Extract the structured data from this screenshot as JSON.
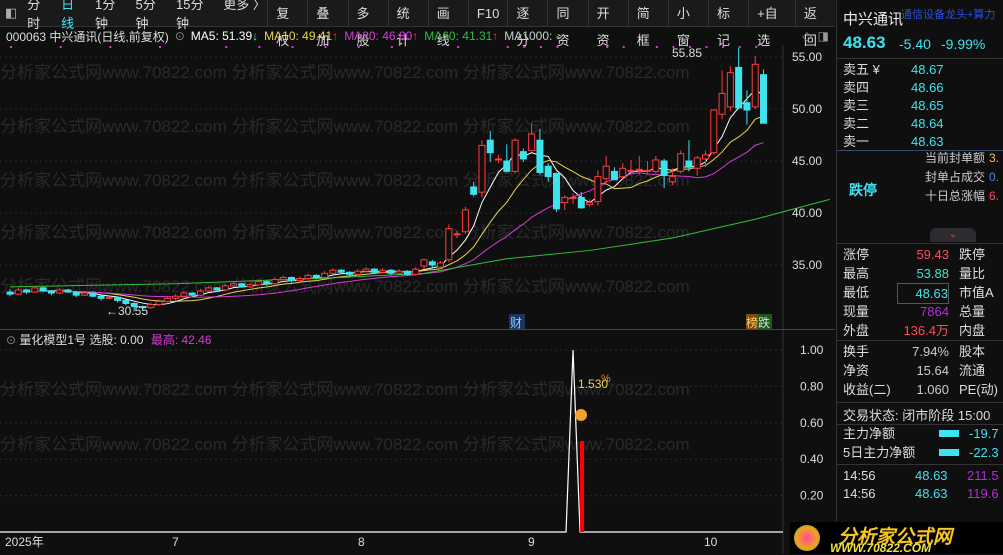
{
  "toolbar": {
    "left": [
      "分时",
      "日线",
      "1分钟",
      "5分钟",
      "15分钟",
      "更多 〉"
    ],
    "active": 1,
    "right": [
      "复权",
      "叠加",
      "多股",
      "统计",
      "画线",
      "F10",
      "逐分",
      "同资",
      "开资",
      "简框",
      "小窗",
      "标记",
      "+自选",
      "返回"
    ]
  },
  "legend": {
    "title": "000063 中兴通讯(日线,前复权)",
    "ma5": "MA5: 51.39",
    "ma5_arrow": "↓",
    "ma10": "MA10: 49.41",
    "ma10_arrow": "↑",
    "ma20": "MA20: 46.80",
    "ma20_arrow": "↑",
    "ma60": "MA60: 41.31",
    "ma60_arrow": "↑",
    "ma1000": "MA1000: -"
  },
  "colors": {
    "up": "#ff3b3b",
    "down": "#3ee3f0",
    "ma5": "#ffffff",
    "ma10": "#e8d44d",
    "ma20": "#d63ad6",
    "ma60": "#2fbf3a"
  },
  "watermark": "分析家公式网www.70822.com 分析家公式网www.70822.com 分析家公式网www.70822.com",
  "chart_data": {
    "type": "candlestick",
    "y_ticks": [
      "55.00",
      "50.00",
      "45.00",
      "40.00",
      "35.00"
    ],
    "ylim": [
      29.5,
      57.5
    ],
    "high_label": "55.85",
    "low_label": "←30.55",
    "markers": {
      "cai": "财",
      "bang": "榜",
      "die": "跌"
    },
    "ohlc": [
      [
        32.4,
        32.7,
        32.0,
        32.2
      ],
      [
        32.2,
        32.8,
        32.1,
        32.6
      ],
      [
        32.6,
        32.7,
        32.2,
        32.4
      ],
      [
        32.4,
        33.0,
        32.3,
        32.8
      ],
      [
        32.8,
        32.9,
        32.4,
        32.5
      ],
      [
        32.5,
        32.6,
        32.1,
        32.3
      ],
      [
        32.3,
        32.8,
        32.2,
        32.6
      ],
      [
        32.6,
        32.7,
        32.3,
        32.4
      ],
      [
        32.4,
        32.5,
        31.9,
        32.1
      ],
      [
        32.1,
        32.5,
        32.0,
        32.3
      ],
      [
        32.3,
        32.4,
        31.9,
        32.0
      ],
      [
        32.0,
        32.1,
        31.6,
        31.8
      ],
      [
        31.8,
        32.1,
        31.7,
        31.9
      ],
      [
        31.9,
        32.0,
        31.4,
        31.6
      ],
      [
        31.6,
        31.7,
        31.1,
        31.3
      ],
      [
        31.3,
        31.4,
        30.55,
        31.0
      ],
      [
        31.0,
        31.1,
        30.7,
        30.9
      ],
      [
        30.9,
        31.4,
        30.8,
        31.2
      ],
      [
        31.2,
        31.7,
        31.1,
        31.5
      ],
      [
        31.5,
        32.0,
        31.4,
        31.8
      ],
      [
        31.8,
        32.2,
        31.6,
        32.0
      ],
      [
        32.0,
        32.5,
        31.9,
        32.3
      ],
      [
        32.3,
        32.4,
        31.9,
        32.1
      ],
      [
        32.1,
        32.7,
        32.0,
        32.5
      ],
      [
        32.5,
        33.0,
        32.4,
        32.8
      ],
      [
        32.8,
        32.9,
        32.4,
        32.6
      ],
      [
        32.6,
        33.2,
        32.5,
        33.0
      ],
      [
        33.0,
        33.4,
        32.9,
        33.2
      ],
      [
        33.2,
        33.3,
        32.8,
        32.9
      ],
      [
        32.9,
        33.3,
        32.8,
        33.1
      ],
      [
        33.1,
        33.6,
        33.0,
        33.4
      ],
      [
        33.4,
        33.5,
        33.0,
        33.2
      ],
      [
        33.2,
        33.8,
        33.1,
        33.6
      ],
      [
        33.6,
        34.0,
        33.5,
        33.8
      ],
      [
        33.8,
        33.9,
        33.3,
        33.5
      ],
      [
        33.5,
        33.9,
        33.4,
        33.7
      ],
      [
        33.7,
        34.2,
        33.6,
        34.0
      ],
      [
        34.0,
        34.1,
        33.6,
        33.8
      ],
      [
        33.8,
        34.4,
        33.7,
        34.2
      ],
      [
        34.2,
        34.7,
        34.1,
        34.5
      ],
      [
        34.5,
        34.6,
        34.1,
        34.3
      ],
      [
        34.3,
        34.4,
        33.9,
        34.1
      ],
      [
        34.1,
        34.6,
        34.0,
        34.4
      ],
      [
        34.4,
        34.8,
        34.3,
        34.6
      ],
      [
        34.6,
        34.7,
        34.1,
        34.3
      ],
      [
        34.3,
        34.7,
        34.2,
        34.5
      ],
      [
        34.5,
        34.6,
        34.0,
        34.2
      ],
      [
        34.2,
        34.6,
        34.1,
        34.4
      ],
      [
        34.4,
        34.5,
        34.0,
        34.1
      ],
      [
        34.1,
        34.8,
        34.0,
        34.6
      ],
      [
        34.9,
        35.6,
        34.6,
        35.5
      ],
      [
        35.3,
        35.5,
        34.8,
        35.0
      ],
      [
        34.8,
        35.4,
        34.6,
        35.2
      ],
      [
        35.5,
        38.9,
        35.3,
        38.5
      ],
      [
        38.0,
        38.3,
        37.6,
        38.0
      ],
      [
        38.2,
        40.6,
        38.0,
        40.3
      ],
      [
        42.5,
        43.0,
        41.6,
        41.8
      ],
      [
        42.0,
        47.0,
        41.5,
        46.5
      ],
      [
        47.0,
        47.9,
        44.9,
        45.8
      ],
      [
        45.2,
        45.6,
        44.8,
        45.2
      ],
      [
        45.0,
        46.6,
        43.9,
        44.0
      ],
      [
        44.0,
        47.2,
        43.8,
        47.0
      ],
      [
        45.9,
        46.2,
        44.9,
        45.2
      ],
      [
        46.0,
        48.7,
        45.9,
        47.6
      ],
      [
        47.0,
        48.1,
        43.7,
        43.9
      ],
      [
        44.5,
        44.8,
        43.0,
        43.5
      ],
      [
        43.8,
        43.9,
        40.1,
        40.4
      ],
      [
        41.0,
        41.7,
        40.3,
        41.5
      ],
      [
        41.5,
        41.9,
        40.9,
        41.5
      ],
      [
        41.5,
        42.0,
        40.4,
        40.5
      ],
      [
        40.8,
        41.3,
        40.6,
        41.0
      ],
      [
        41.1,
        44.1,
        40.7,
        43.5
      ],
      [
        43.3,
        45.5,
        42.7,
        44.5
      ],
      [
        44.0,
        44.4,
        43.2,
        43.2
      ],
      [
        43.5,
        44.8,
        43.2,
        44.3
      ],
      [
        44.1,
        45.1,
        43.9,
        44.1
      ],
      [
        44.2,
        45.5,
        43.7,
        44.2
      ],
      [
        44.1,
        45.0,
        43.8,
        44.1
      ],
      [
        44.0,
        45.5,
        43.8,
        45.1
      ],
      [
        45.0,
        45.2,
        42.4,
        43.6
      ],
      [
        43.0,
        44.3,
        42.7,
        43.5
      ],
      [
        44.0,
        46.0,
        43.8,
        45.7
      ],
      [
        45.0,
        47.0,
        44.0,
        44.4
      ],
      [
        44.3,
        45.5,
        43.6,
        45.3
      ],
      [
        45.2,
        46.0,
        44.4,
        45.6
      ],
      [
        45.8,
        50.0,
        45.6,
        49.9
      ],
      [
        49.5,
        53.7,
        49.0,
        51.5
      ],
      [
        50.2,
        54.1,
        49.8,
        53.5
      ],
      [
        54.0,
        55.85,
        50.0,
        50.1
      ],
      [
        50.6,
        51.8,
        48.5,
        49.9
      ],
      [
        50.2,
        55.1,
        50.0,
        54.3
      ],
      [
        53.3,
        53.8,
        48.63,
        48.63
      ]
    ],
    "ma60": [
      [
        0,
        32.9
      ],
      [
        20,
        33.2
      ],
      [
        40,
        33.8
      ],
      [
        50,
        34.2
      ],
      [
        60,
        35.6
      ],
      [
        70,
        36.4
      ],
      [
        80,
        37.6
      ],
      [
        90,
        39.4
      ],
      [
        99,
        41.31
      ]
    ]
  },
  "indicator": {
    "title": "量化模型1号",
    "pick": "选股: 0.00",
    "high": "最高: 42.46",
    "label": "1.530",
    "pct": "%",
    "y_ticks": [
      "1.00",
      "0.80",
      "0.60",
      "0.40",
      "0.20"
    ],
    "signal_index": 68,
    "signal_value": 1.0,
    "bar_value": 0.5
  },
  "x_axis": [
    "2025年",
    "7",
    "8",
    "9",
    "10"
  ],
  "panel": {
    "name": "中兴通讯",
    "tagline": "通信设备龙头+算力",
    "price": "48.63",
    "change": "-5.40",
    "pct": "-9.99%",
    "asks": [
      {
        "l": "卖五 ¥",
        "v": "48.67"
      },
      {
        "l": "卖四",
        "v": "48.66"
      },
      {
        "l": "卖三",
        "v": "48.65"
      },
      {
        "l": "卖二",
        "v": "48.64"
      },
      {
        "l": "卖一",
        "v": "48.63"
      }
    ],
    "limit_status": "跌停",
    "seal": [
      {
        "l": "当前封单额",
        "v": "3."
      },
      {
        "l": "封单占成交",
        "v": "0."
      },
      {
        "l": "十日总涨幅",
        "v": "6."
      }
    ],
    "stats": [
      {
        "l": "涨停",
        "v": "59.43",
        "c": "#ff4a5a",
        "l2": "跌停"
      },
      {
        "l": "最高",
        "v": "53.88",
        "c": "#3ee3c8",
        "l2": "量比"
      },
      {
        "l": "最低",
        "v": "48.63",
        "c": "#3ee3f0",
        "l2": "市值A"
      },
      {
        "l": "现量",
        "v": "7864",
        "c": "#b030d0",
        "l2": "总量"
      },
      {
        "l": "外盘",
        "v": "136.4万",
        "c": "#ff4a5a",
        "l2": "内盘"
      }
    ],
    "stats2": [
      {
        "l": "换手",
        "v": "7.94%",
        "l2": "股本"
      },
      {
        "l": "净资",
        "v": "15.64",
        "l2": "流通"
      },
      {
        "l": "收益(二)",
        "v": "1.060",
        "l2": "PE(动)"
      }
    ],
    "trade_state": "交易状态: 闭市阶段 15:00",
    "flows": [
      {
        "l": "主力净额",
        "v": "-19.7"
      },
      {
        "l": "5日主力净额",
        "v": "-22.3"
      }
    ],
    "ticks": [
      {
        "t": "14:56",
        "p": "48.63",
        "v": "211.5"
      },
      {
        "t": "14:56",
        "p": "48.63",
        "v": "119.6"
      }
    ],
    "logo_title": "分析家公式网",
    "logo_url": "WWW.70822.COM"
  }
}
